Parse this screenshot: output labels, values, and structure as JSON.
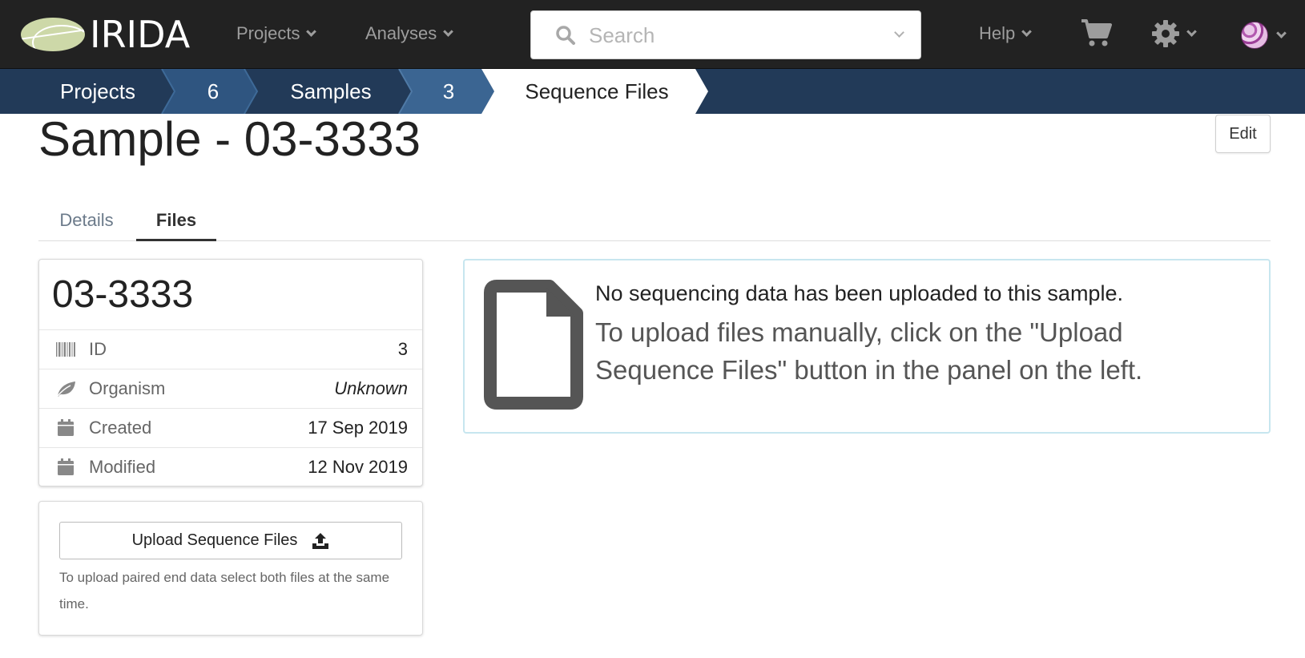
{
  "navbar": {
    "logo_text": "IRIDA",
    "projects_label": "Projects",
    "analyses_label": "Analyses",
    "search_placeholder": "Search",
    "help_label": "Help"
  },
  "breadcrumb": {
    "items": [
      "Projects",
      "6",
      "Samples",
      "3",
      "Sequence Files"
    ]
  },
  "page": {
    "title": "Sample - 03-3333",
    "edit_label": "Edit"
  },
  "tabs": {
    "details_label": "Details",
    "files_label": "Files"
  },
  "sample_panel": {
    "name": "03-3333",
    "rows": [
      {
        "label": "ID",
        "value": "3",
        "icon": "barcode-icon"
      },
      {
        "label": "Organism",
        "value": "Unknown",
        "icon": "leaf-icon"
      },
      {
        "label": "Created",
        "value": "17 Sep 2019",
        "icon": "calendar-icon"
      },
      {
        "label": "Modified",
        "value": "12 Nov 2019",
        "icon": "calendar-icon"
      }
    ]
  },
  "upload": {
    "button_label": "Upload Sequence Files",
    "help_text": "To upload paired end data select both files at the same time."
  },
  "alert": {
    "title": "No sequencing data has been uploaded to this sample.",
    "body": "To upload files manually, click on the \"Upload Sequence Files\" button in the panel on the left."
  },
  "colors": {
    "navbar_bg": "#222222",
    "breadcrumb_bg": "#223a58",
    "breadcrumb_step": "#3b6592",
    "breadcrumb_mid": "#2f5580",
    "alert_border": "#c7e6ef"
  }
}
